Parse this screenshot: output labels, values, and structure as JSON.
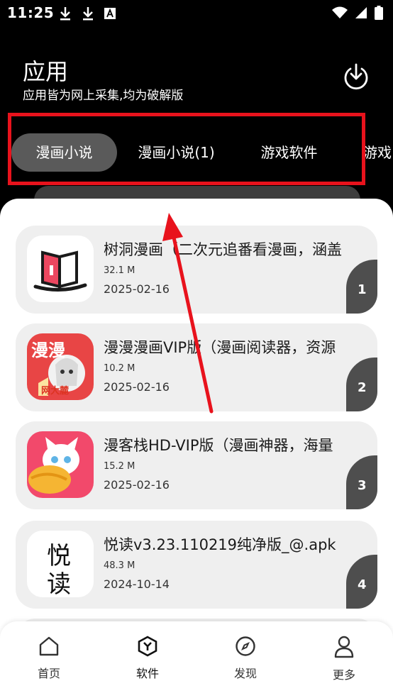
{
  "status": {
    "time": "11:25",
    "left_icons": [
      "download-icon",
      "download-icon",
      "font-icon"
    ],
    "right_icons": [
      "wifi-icon",
      "signal-icon",
      "battery-icon"
    ]
  },
  "header": {
    "title": "应用",
    "subtitle": "应用皆为网上采集,均为破解版",
    "download_icon": "download-circle-icon"
  },
  "tabs": [
    {
      "label": "漫画小说",
      "active": true
    },
    {
      "label": "漫画小说(1)",
      "active": false
    },
    {
      "label": "游戏软件",
      "active": false
    },
    {
      "label": "游戏",
      "active": false
    }
  ],
  "apps": [
    {
      "title": "树洞漫画（二次元追番看漫画，涵盖",
      "size": "32.1 M",
      "date": "2025-02-16",
      "rank": "1"
    },
    {
      "title": "漫漫漫画VIP版（漫画阅读器，资源",
      "size": "10.2 M",
      "date": "2025-02-16",
      "rank": "2"
    },
    {
      "title": "漫客栈HD-VIP版（漫画神器，海量",
      "size": "15.2 M",
      "date": "2025-02-16",
      "rank": "3"
    },
    {
      "title": "悦读v3.23.110219纯净版_@.apk",
      "size": "48.3 M",
      "date": "2024-10-14",
      "rank": "4"
    }
  ],
  "icon_texts": {
    "manman_top": "漫漫",
    "manman_bottom": "网大麓",
    "yuedu_1": "悦",
    "yuedu_2": "读"
  },
  "nav": [
    {
      "label": "首页",
      "icon": "home-icon"
    },
    {
      "label": "软件",
      "icon": "software-icon"
    },
    {
      "label": "发现",
      "icon": "compass-icon"
    },
    {
      "label": "更多",
      "icon": "user-icon"
    }
  ],
  "colors": {
    "background": "#000000",
    "highlight": "#e8121c",
    "active_tab": "#5a5a5a",
    "card_bg": "#efefef",
    "rank_bg": "#4e4e4e"
  }
}
